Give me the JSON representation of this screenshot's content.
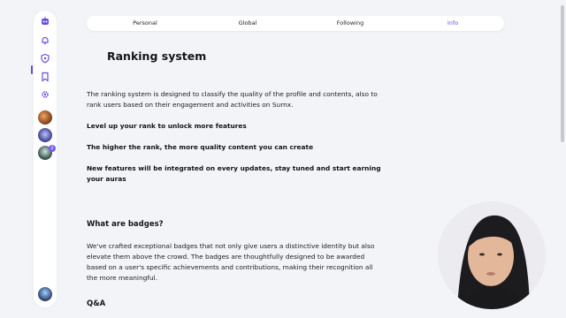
{
  "rail": {
    "items": [
      {
        "icon": "robot-logo-icon"
      },
      {
        "icon": "bell-icon"
      },
      {
        "icon": "shield-icon"
      },
      {
        "icon": "bookmark-icon"
      },
      {
        "icon": "gear-icon"
      }
    ],
    "notification_count": "2",
    "accent": "#6b4be6"
  },
  "tabs": [
    {
      "label": "Personal"
    },
    {
      "label": "Global"
    },
    {
      "label": "Following"
    },
    {
      "label": "Info"
    }
  ],
  "content": {
    "title": "Ranking system",
    "intro": "The ranking system is designed to classify the quality of the profile and contents, also to rank users based on their engagement and activities on Surnx.",
    "point1": "Level up your rank to unlock more features",
    "point2": "The higher the rank, the more quality content you can create",
    "point3": "New features will be integrated on every updates, stay tuned and start earning your auras",
    "badges_heading": "What are badges?",
    "badges_text": "We've crafted exceptional badges that not only give users a distinctive identity but also elevate them above the crowd. The badges are thoughtfully designed to be awarded based on a user's specific achievements and contributions, making their recognition all the more meaningful.",
    "qa_heading": "Q&A"
  }
}
